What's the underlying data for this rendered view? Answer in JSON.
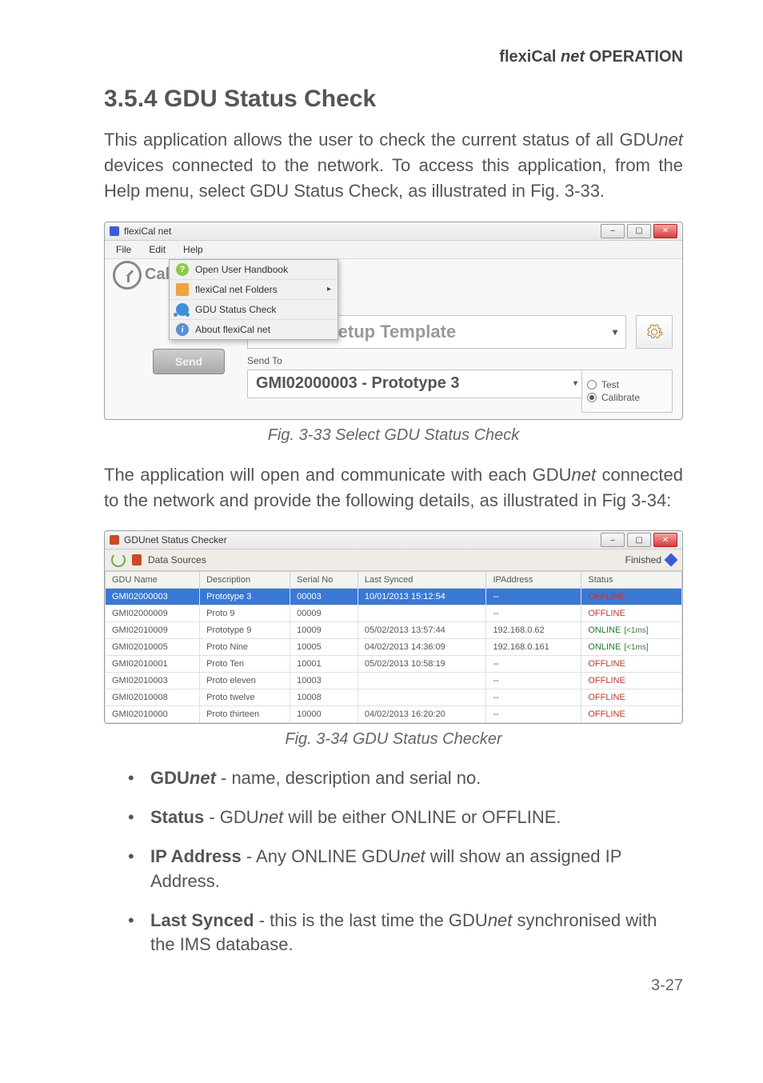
{
  "header": {
    "product": "flexiCal",
    "product_italic": "net",
    "section": "OPERATION"
  },
  "heading": "3.5.4  GDU Status Check",
  "para1": "This application allows the user to check the current status of all GDUnet devices connected to the network. To access this application, from the Help menu, select GDU Status Check, as illustrated in Fig. 3-33.",
  "fig1_caption": "Fig. 3-33  Select GDU Status Check",
  "para2": "The application will open and communicate with each GDUnet connected to the network and provide the following details, as illustrated in Fig 3-34:",
  "fig2_caption": "Fig. 3-34  GDU Status Checker",
  "bullets": {
    "b1_bold": "GDUnet",
    "b1_rest": " - name, description and serial no.",
    "b2_bold": "Status",
    "b2_rest": " - GDUnet will be either ONLINE or OFFLINE.",
    "b3_bold": "IP Address",
    "b3_rest": " - Any ONLINE GDUnet will show an assigned IP Address.",
    "b4_bold": "Last Synced",
    "b4_rest": " - this is the last time the GDUnet synchronised with the IMS database."
  },
  "page_number": "3-27",
  "win1": {
    "title": "flexiCal net",
    "menu": {
      "file": "File",
      "edit": "Edit",
      "help": "Help"
    },
    "cal_label": "Cal",
    "help_items": {
      "open_handbook": "Open User Handbook",
      "folders": "flexiCal net Folders",
      "status_check": "GDU Status Check",
      "about": "About flexiCal net"
    },
    "template_text": "GDUnet Setup Template",
    "send_label": "Send",
    "sendto_label": "Send To",
    "combo_text": "GMI02000003 - Prototype 3",
    "radio_test": "Test",
    "radio_cal": "Calibrate"
  },
  "win2": {
    "title": "GDUnet Status Checker",
    "data_sources": "Data Sources",
    "finished": "Finished",
    "headers": {
      "name": "GDU Name",
      "desc": "Description",
      "serial": "Serial No",
      "synced": "Last Synced",
      "ip": "IPAddress",
      "status": "Status"
    },
    "rows": [
      {
        "name": "GMI02000003",
        "desc": "Prototype 3",
        "serial": "00003",
        "synced": "10/01/2013 15:12:54",
        "ip": "--",
        "status": "OFFLINE",
        "online": false,
        "lat": "",
        "selected": true
      },
      {
        "name": "GMI02000009",
        "desc": "Proto 9",
        "serial": "00009",
        "synced": "",
        "ip": "--",
        "status": "OFFLINE",
        "online": false,
        "lat": ""
      },
      {
        "name": "GMI02010009",
        "desc": "Prototype 9",
        "serial": "10009",
        "synced": "05/02/2013 13:57:44",
        "ip": "192.168.0.62",
        "status": "ONLINE",
        "online": true,
        "lat": "[<1ms]"
      },
      {
        "name": "GMI02010005",
        "desc": "Proto Nine",
        "serial": "10005",
        "synced": "04/02/2013 14:36:09",
        "ip": "192.168.0.161",
        "status": "ONLINE",
        "online": true,
        "lat": "[<1ms]"
      },
      {
        "name": "GMI02010001",
        "desc": "Proto Ten",
        "serial": "10001",
        "synced": "05/02/2013 10:58:19",
        "ip": "--",
        "status": "OFFLINE",
        "online": false,
        "lat": ""
      },
      {
        "name": "GMI02010003",
        "desc": "Proto eleven",
        "serial": "10003",
        "synced": "",
        "ip": "--",
        "status": "OFFLINE",
        "online": false,
        "lat": ""
      },
      {
        "name": "GMI02010008",
        "desc": "Proto twelve",
        "serial": "10008",
        "synced": "",
        "ip": "--",
        "status": "OFFLINE",
        "online": false,
        "lat": ""
      },
      {
        "name": "GMI02010000",
        "desc": "Proto thirteen",
        "serial": "10000",
        "synced": "04/02/2013 16:20:20",
        "ip": "--",
        "status": "OFFLINE",
        "online": false,
        "lat": ""
      }
    ]
  }
}
